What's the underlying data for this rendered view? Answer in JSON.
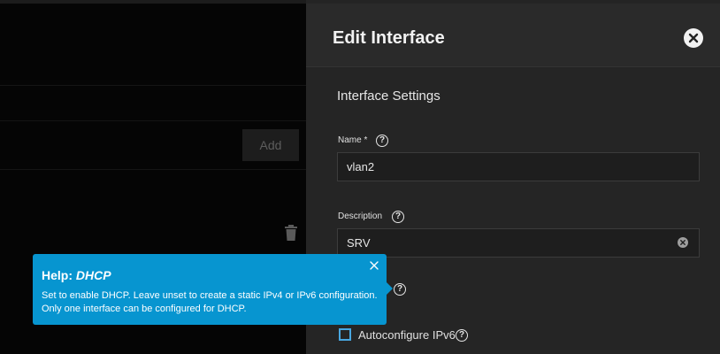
{
  "background": {
    "add_label": "Add"
  },
  "panel": {
    "title": "Edit Interface",
    "section_title": "Interface Settings",
    "name_field": {
      "label": "Name",
      "required_mark": "*",
      "value": "vlan2"
    },
    "description_field": {
      "label": "Description",
      "value": "SRV"
    },
    "ipv6_checkbox": {
      "label": "Autoconfigure IPv6",
      "checked": false
    },
    "help_glyph": "?"
  },
  "tooltip": {
    "prefix": "Help:",
    "topic": "DHCP",
    "text": "Set to enable DHCP. Leave unset to create a static IPv4 or IPv6 configuration. Only one interface can be configured for DHCP."
  },
  "colors": {
    "accent": "#0795d0",
    "checkbox_border": "#49a7e0",
    "panel_bg": "#242424"
  }
}
